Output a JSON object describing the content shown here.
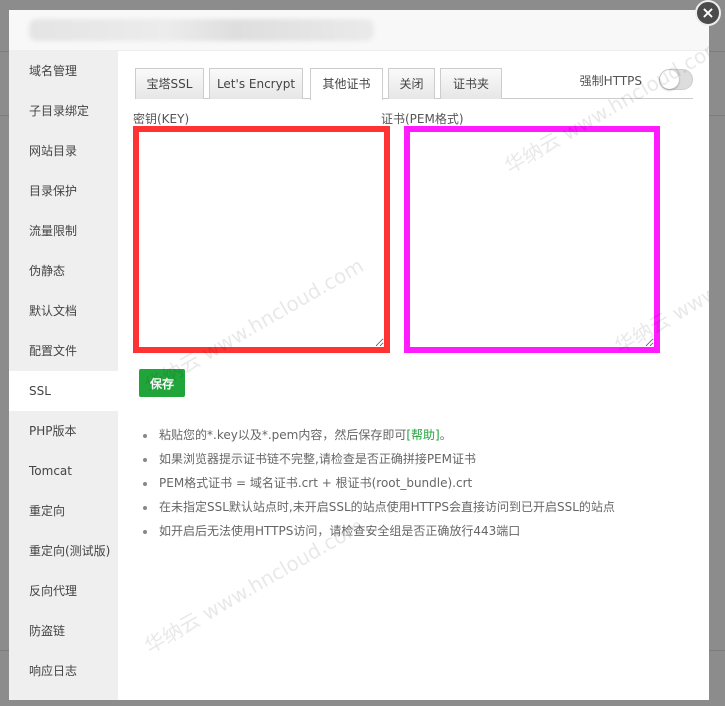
{
  "sidebar": {
    "items": [
      "域名管理",
      "子目录绑定",
      "网站目录",
      "目录保护",
      "流量限制",
      "伪静态",
      "默认文档",
      "配置文件",
      "SSL",
      "PHP版本",
      "Tomcat",
      "重定向",
      "重定向(测试版)",
      "反向代理",
      "防盗链",
      "响应日志"
    ],
    "active": "SSL"
  },
  "tabs": [
    "宝塔SSL",
    "Let's Encrypt",
    "其他证书",
    "关闭",
    "证书夹"
  ],
  "active_tab": "其他证书",
  "force_https": {
    "label": "强制HTTPS",
    "enabled": false
  },
  "key_field": {
    "label": "密钥(KEY)",
    "value": "",
    "border_color": "#ff3333"
  },
  "cert_field": {
    "label": "证书(PEM格式)",
    "value": "",
    "border_color": "#ff1aff"
  },
  "save_label": "保存",
  "tips": {
    "t0": "粘贴您的*.key以及*.pem内容，然后保存即可",
    "help": "[帮助]",
    "t0_end": "。",
    "t1": "如果浏览器提示证书链不完整,请检查是否正确拼接PEM证书",
    "t2": "PEM格式证书 = 域名证书.crt + 根证书(root_bundle).crt",
    "t3": "在未指定SSL默认站点时,未开启SSL的站点使用HTTPS会直接访问到已开启SSL的站点",
    "t4": "如开启后无法使用HTTPS访问，请检查安全组是否正确放行443端口"
  },
  "watermark": "华纳云 www.hncloud.com",
  "accent": "#20a53a"
}
